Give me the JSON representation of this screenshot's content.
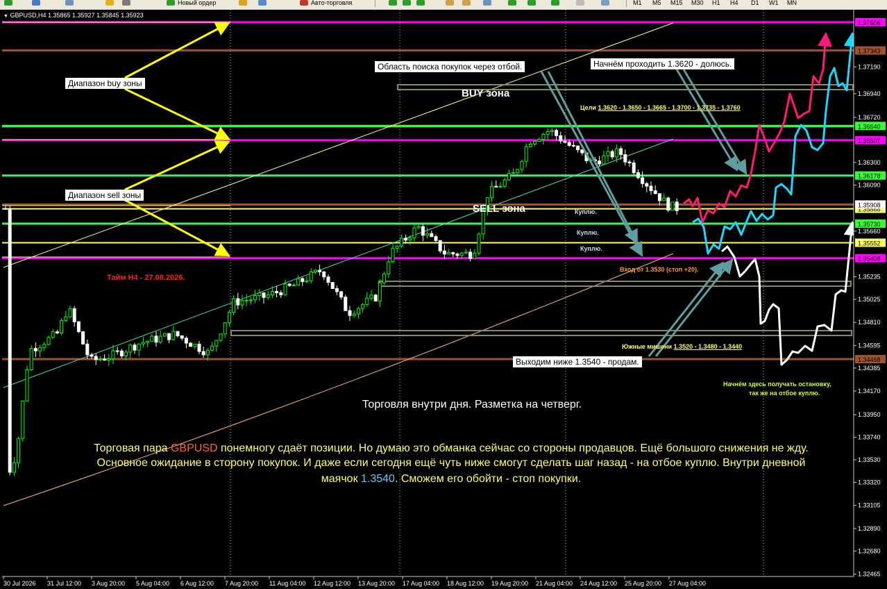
{
  "window": {
    "symbol_header": "GBPUSD,H4  1.35865 1.35927 1.35845 1.35923"
  },
  "toolbar": {
    "new_order_label": "Новый ордер",
    "autotrading_label": "Авто-торговля",
    "timeframes": [
      "M1",
      "M5",
      "M15",
      "M30",
      "H1",
      "H4",
      "D1",
      "W1",
      "MN"
    ]
  },
  "colors": {
    "background": "#000000",
    "bull": "#00ff00",
    "bear": "#ffffff",
    "magenta": "#ff00ff",
    "brown": "#a0522d",
    "green_level": "#33ff33",
    "yellow_level": "#ffff66",
    "forecast_pink": "#ff1a75",
    "forecast_cyan": "#1ad9ff",
    "forecast_white": "#ffffff",
    "box_border": "#8a8a5c"
  },
  "chart_data": {
    "type": "candlestick",
    "symbol": "GBPUSD",
    "timeframe": "H4",
    "y_ticks": [
      "1.37190",
      "1.36940",
      "1.36720",
      "1.36300",
      "1.36090",
      "1.35660",
      "1.35235",
      "1.35025",
      "1.34810",
      "1.34595",
      "1.34385",
      "1.34170",
      "1.33950",
      "1.33740",
      "1.33530",
      "1.33320",
      "1.33105",
      "1.32890",
      "1.32680",
      "1.32465"
    ],
    "x_ticks": [
      "30 Jul 2026",
      "31 Jul 12:00",
      "3 Aug 20:00",
      "5 Aug 04:00",
      "6 Aug 12:00",
      "7 Aug 20:00",
      "11 Aug 04:00",
      "12 Aug 12:00",
      "13 Aug 20:00",
      "17 Aug 04:00",
      "18 Aug 12:00",
      "19 Aug 20:00",
      "21 Aug 04:00",
      "24 Aug 12:00",
      "25 Aug 20:00",
      "27 Aug 04:00"
    ],
    "levels": [
      {
        "price": 1.37606,
        "color": "#ff00ff",
        "label": "1.37606"
      },
      {
        "price": 1.37343,
        "color": "#a0522d",
        "label": "1.37343"
      },
      {
        "price": 1.3664,
        "color": "#33ff33",
        "label": "1.36640"
      },
      {
        "price": 1.36507,
        "color": "#ff00ff",
        "label": "1.36507"
      },
      {
        "price": 1.36178,
        "color": "#33ff33",
        "label": "1.36178"
      },
      {
        "price": 1.35908,
        "color": "#a0522d",
        "label": ""
      },
      {
        "price": 1.35868,
        "color": "#ffff66",
        "label": "1.35868"
      },
      {
        "price": 1.3573,
        "color": "#33ff33",
        "label": "1.35730"
      },
      {
        "price": 1.35552,
        "color": "#ffff66",
        "label": "1.35552"
      },
      {
        "price": 1.35408,
        "color": "#ff00ff",
        "label": "1.35408"
      },
      {
        "price": 1.34468,
        "color": "#a0522d",
        "label": "1.34468"
      }
    ],
    "current_price": {
      "price": 1.35908,
      "label": "1.35908"
    },
    "annotations": {
      "buy_range": "Диапазон buy зоны",
      "sell_range": "Диапазон sell зоны",
      "search_area": "Область поиска покупок через отбой.",
      "pass_level": "Начнём проходить 1.3620 - долюсь.",
      "buy_zone": "BUY зона",
      "sell_zone": "SELL зона",
      "targets_prefix": "Цели ",
      "targets_values": "1.3620 - 1.3650 - 1.3665 - 1.3700 - 1.3735 - 1.3760",
      "buy1": "Куплю.",
      "buy2": "Куплю.",
      "buy3": "Куплю.",
      "entry": "Вход от 1.3530 (стоп +20).",
      "south_prefix": "Южные мишени ",
      "south_values": "1.3520 - 1.3480 - 1.3440",
      "exit": "Выходим ниже 1.3540 - продам.",
      "stop_note_1": "Начнём здесь получать остановку,",
      "stop_note_2": "так же на отбое куплю.",
      "timeframe_note": "Тайм H4 - 27.08.2026."
    },
    "text_block": {
      "title": "Торговля внутри дня. Разметка на четверг.",
      "p1_a": "Торговая пара ",
      "p1_pair": "GBPUSD",
      "p1_b": " понемногу сдаёт позиции. Но думаю это обманка сейчас со стороны продавцов. Ещё большого снижения не жду.",
      "p2": "Основное ожидание в сторону покупок. И даже если сегодня ещё чуть ниже смогут сделать шаг назад - на отбое куплю. Внутри дневной",
      "p3_a": "маячок ",
      "p3_level": "1.3540",
      "p3_b": ". Сможем его обойти - стоп покупки."
    }
  }
}
